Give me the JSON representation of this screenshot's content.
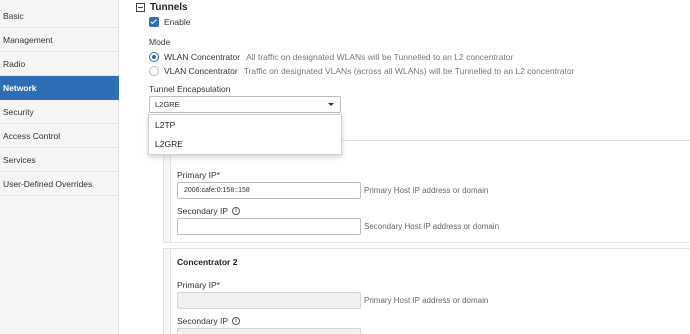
{
  "sidebar": {
    "items": [
      {
        "label": "Basic",
        "active": false
      },
      {
        "label": "Management",
        "active": false
      },
      {
        "label": "Radio",
        "active": false
      },
      {
        "label": "Network",
        "active": true
      },
      {
        "label": "Security",
        "active": false
      },
      {
        "label": "Access Control",
        "active": false
      },
      {
        "label": "Services",
        "active": false
      },
      {
        "label": "User-Defined Overrides",
        "active": false
      }
    ]
  },
  "tunnels": {
    "title": "Tunnels",
    "enable_label": "Enable",
    "enable_checked": true,
    "mode_label": "Mode",
    "modes": [
      {
        "name": "WLAN Concentrator",
        "desc": "All traffic on designated WLANs will be Tunnelled to an L2 concentrator",
        "selected": true
      },
      {
        "name": "VLAN Concentrator",
        "desc": "Traffic on designated VLANs (across all WLANs) will be Tunnelled to an L2 concentrator",
        "selected": false
      }
    ],
    "encapsulation_label": "Tunnel Encapsulation",
    "encapsulation_value": "L2GRE",
    "encapsulation_options": [
      "L2TP",
      "L2GRE"
    ]
  },
  "concentrator1": {
    "primary_label": "Primary IP*",
    "primary_value": "2006:cafe:0:158::158",
    "primary_help": "Primary Host IP address or domain",
    "secondary_label": "Secondary IP",
    "secondary_value": "",
    "secondary_help": "Secondary Host IP address or domain"
  },
  "concentrator2": {
    "title": "Concentrator 2",
    "primary_label": "Primary IP*",
    "primary_value": "",
    "primary_help": "Primary Host IP address or domain",
    "secondary_label": "Secondary IP"
  },
  "colors": {
    "accent": "#2e6eb5",
    "sidebar_bg": "#f5f5f5"
  }
}
